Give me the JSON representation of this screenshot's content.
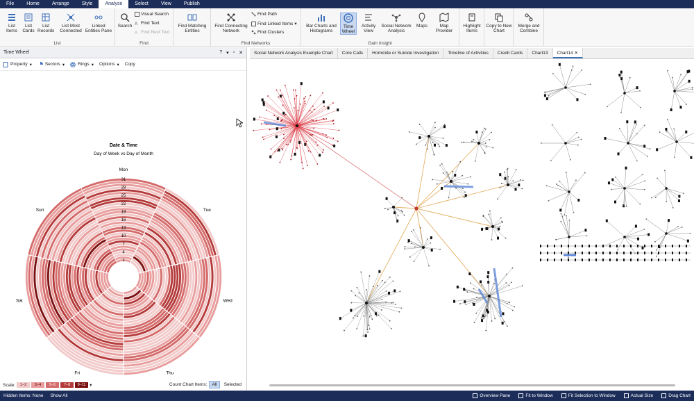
{
  "menu": [
    "File",
    "Home",
    "Arrange",
    "Style",
    "Analyse",
    "Select",
    "View",
    "Publish"
  ],
  "ribbon": {
    "list": {
      "title": "List",
      "items": [
        "List Items",
        "List Cards",
        "List Records",
        "List Most Connected",
        "Linked Entities Pane"
      ]
    },
    "find": {
      "title": "Find",
      "search": "Search",
      "visual_search": "Visual Search",
      "find_text": "Find Text",
      "find_next_text": "Find Next Text"
    },
    "matching": {
      "label": "Find Matching Entities"
    },
    "networks": {
      "title": "Find Networks",
      "connecting": "Find Connecting Network",
      "find_path": "Find Path",
      "find_linked": "Find Linked Items",
      "find_clusters": "Find Clusters"
    },
    "gain": {
      "title": "Gain Insight",
      "bar": "Bar Charts and Histograms",
      "time_wheel": "Time Wheel",
      "activity": "Activity View",
      "sna": "Social Network Analysis",
      "maps": "Maps",
      "map_provider": "Map Provider"
    },
    "highlight": "Highlight Items",
    "copy_new": "Copy to New Chart",
    "merge": "Merge and Combine"
  },
  "pane": {
    "title": "Time Wheel",
    "toolbar": {
      "property": "Property",
      "sectors": "Sectors",
      "rings": "Rings",
      "options": "Options",
      "copy": "Copy"
    },
    "wheel": {
      "title": "Date & Time",
      "subtitle": "Day of Week vs Day of Month",
      "days": [
        "Mon",
        "Tue",
        "Wed",
        "Thu",
        "Fri",
        "Sat",
        "Sun"
      ],
      "ring_labels": [
        "31",
        "28",
        "25",
        "22",
        "19",
        "16",
        "13",
        "10",
        "7",
        "4",
        "1"
      ]
    },
    "scale": {
      "label": "Scale:",
      "bands": [
        "1–2",
        "3–4",
        "5–6",
        "7–8",
        "9–11"
      ],
      "colors": [
        "#f2c9c9",
        "#e89c9c",
        "#d46a6a",
        "#b43a3a",
        "#7a1010"
      ]
    },
    "count": {
      "label": "Count Chart Items:",
      "all": "All",
      "selected": "Selected"
    }
  },
  "tabs": [
    "Social Network Analysis Example Chart",
    "Core Calls",
    "Homicide or Suicide Investigation",
    "Timeline of Activities",
    "Credit Cards",
    "Chart13",
    "Chart14"
  ],
  "active_tab": "Chart14",
  "status": {
    "hidden": "Hidden Items: None",
    "show_all": "Show All",
    "overview": "Overview Pane",
    "fit_window": "Fit to Window",
    "fit_selection": "Fit Selection to Window",
    "actual": "Actual Size",
    "drag": "Drag Chart"
  }
}
